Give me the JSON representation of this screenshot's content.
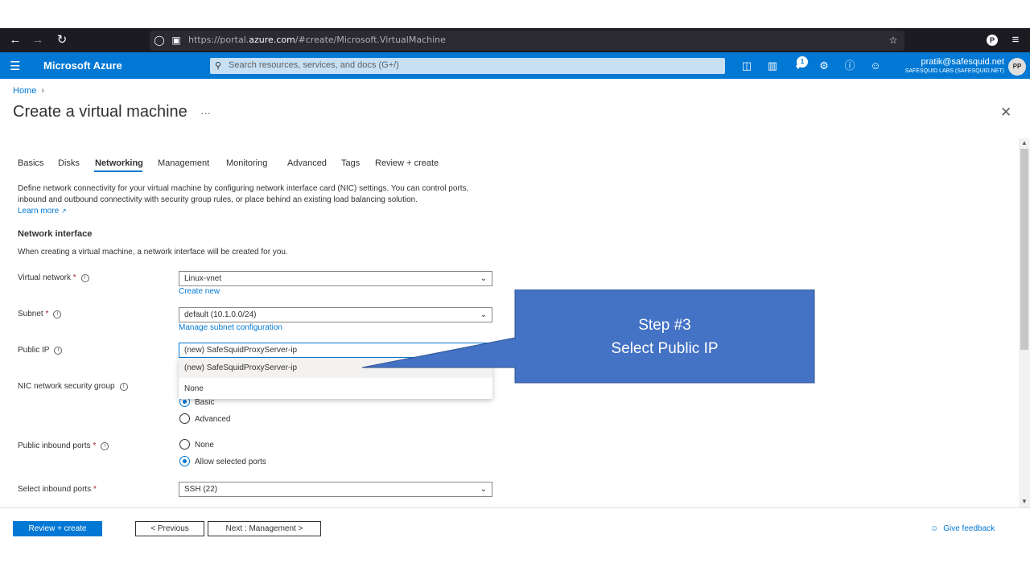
{
  "browser": {
    "url_prefix": "https://portal.",
    "url_domain": "azure.com",
    "url_path": "/#create/Microsoft.VirtualMachine",
    "profile_initial": "P"
  },
  "portal": {
    "brand": "Microsoft Azure",
    "search_placeholder": "Search resources, services, and docs (G+/)",
    "notification_count": "1",
    "user_email": "pratik@safesquid.net",
    "user_org": "SAFESQUID LABS (SAFESQUID.NET)",
    "avatar_initials": "PP",
    "accent_color": "#0078d4"
  },
  "page": {
    "breadcrumb_home": "Home",
    "title": "Create a virtual machine",
    "more": "···"
  },
  "tabs": [
    {
      "label": "Basics"
    },
    {
      "label": "Disks"
    },
    {
      "label": "Networking",
      "active": true
    },
    {
      "label": "Management"
    },
    {
      "label": "Monitoring"
    },
    {
      "label": "Advanced"
    },
    {
      "label": "Tags"
    },
    {
      "label": "Review + create"
    }
  ],
  "networking": {
    "description": "Define network connectivity for your virtual machine by configuring network interface card (NIC) settings. You can control ports, inbound and outbound connectivity with security group rules, or place behind an existing load balancing solution.",
    "learn_more": "Learn more",
    "section_title": "Network interface",
    "section_note": "When creating a virtual machine, a network interface will be created for you.",
    "virtual_network": {
      "label": "Virtual network",
      "value": "Linux-vnet",
      "link": "Create new"
    },
    "subnet": {
      "label": "Subnet",
      "value": "default (10.1.0.0/24)",
      "link": "Manage subnet configuration"
    },
    "public_ip": {
      "label": "Public IP",
      "value": "(new) SafeSquidProxyServer-ip",
      "options": [
        "(new) SafeSquidProxyServer-ip",
        "None"
      ]
    },
    "nic_nsg": {
      "label": "NIC network security group",
      "options": [
        "Basic",
        "Advanced"
      ],
      "selected": "Basic"
    },
    "public_inbound": {
      "label": "Public inbound ports",
      "options": [
        "None",
        "Allow selected ports"
      ],
      "selected": "Allow selected ports"
    },
    "select_inbound": {
      "label": "Select inbound ports",
      "value": "SSH (22)"
    }
  },
  "footer": {
    "review_create": "Review + create",
    "previous": "< Previous",
    "next": "Next : Management >",
    "feedback": "Give feedback"
  },
  "callout": {
    "line1": "Step #3",
    "line2": "Select Public IP",
    "color": "#4472c4"
  }
}
